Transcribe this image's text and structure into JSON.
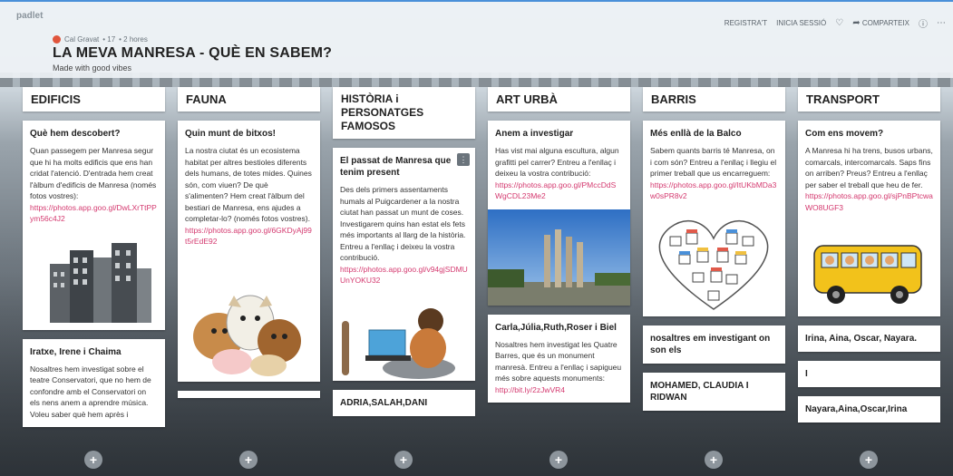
{
  "app": {
    "brand": "padlet"
  },
  "header": {
    "author": "Cal Gravat",
    "likes": "• 17",
    "time": "• 2 hores",
    "title": "LA MEVA MANRESA - QUÈ EN SABEM?",
    "subtitle": "Made with good vibes",
    "register": "REGISTRA'T",
    "login": "INICIA SESSIÓ",
    "share": "COMPARTEIX",
    "heart_icon": "heart-icon",
    "share_icon": "share-icon",
    "help_icon": "help-icon",
    "more_icon": "more-icon"
  },
  "columns": [
    {
      "title": "EDIFICIS",
      "cards": [
        {
          "title": "Què hem descobert?",
          "body": "Quan passegem per Manresa segur que hi ha molts edificis que ens han cridat l'atenció. D'entrada hem creat l'àlbum d'edificis de Manresa (només fotos vostres):",
          "link": "https://photos.app.goo.gl/DwLXrTtPPym56c4J2"
        },
        {
          "title": "Iratxe, Irene i Chaima",
          "body": "Nosaltres hem investigat sobre el teatre Conservatori, que no hem de confondre amb el Conservatori on els nens anem a aprendre música. Voleu saber què hem après i"
        }
      ]
    },
    {
      "title": "FAUNA",
      "cards": [
        {
          "title": "Quin munt de bitxos!",
          "body": "La nostra ciutat és un ecosistema habitat per altres bestioles diferents dels humans, de totes mides. Quines són, com viuen? De què s'alimenten? Hem creat l'àlbum del bestiari de Manresa, ens ajudes a completar-lo? (només fotos vostres).",
          "link": "https://photos.app.goo.gl/6GKDyAj99t5rEdE92"
        }
      ]
    },
    {
      "title": "HISTÒRIA i PERSONATGES FAMOSOS",
      "cards": [
        {
          "title": "El passat de Manresa que tenim present",
          "body": "Des dels primers assentaments humals al Puigcardener a la nostra ciutat han passat un munt de coses. Investigarem quins han estat els fets més importants al llarg de la història. Entreu a l'enllaç i deixeu la vostra contribució.",
          "link": "https://photos.app.goo.gl/v94gjSDMUUnYOKU32",
          "menu": "⋮"
        },
        {
          "title": "ADRIA,SALAH,DANI"
        }
      ]
    },
    {
      "title": "ART URBÀ",
      "cards": [
        {
          "title": "Anem a investigar",
          "body": "Has vist mai alguna escultura, algun grafitti pel carrer? Entreu a l'enllaç i deixeu la vostra contribució:",
          "link": "https://photos.app.goo.gl/PMccDdSWgCDL23Me2"
        },
        {
          "title": "Carla,Júlia,Ruth,Roser i Biel",
          "body": "Nosaltres hem investigat les Quatre Barres, que és un monument manresà. Entreu a l'enllaç i sapigueu més sobre aquests monuments:",
          "link": "http://bit.ly/2zJwVR4"
        }
      ]
    },
    {
      "title": "BARRIS",
      "cards": [
        {
          "title": "Més enllà de la Balco",
          "body": "Sabem quants barris té Manresa, on i com són? Entreu a l'enllaç i llegiu el primer treball que us encarreguem:",
          "link": "https://photos.app.goo.gl/ItUKbMDa3w0sPR8v2"
        },
        {
          "title": "nosaltres em investigant on son els"
        },
        {
          "title": "MOHAMED, CLAUDIA I RIDWAN"
        }
      ]
    },
    {
      "title": "TRANSPORT",
      "cards": [
        {
          "title": "Com ens movem?",
          "body": "A Manresa hi ha trens, busos urbans, comarcals, intercomarcals. Saps fins on arriben? Preus? Entreu a l'enllaç per saber el treball que heu de fer.",
          "link": "https://photos.app.goo.gl/sjPnBPtcwaWO8UGF3"
        },
        {
          "title": "Irina, Aina, Oscar, Nayara."
        },
        {
          "title": "I"
        },
        {
          "title": "Nayara,Aina,Oscar,Irina"
        }
      ]
    }
  ],
  "add_label": "+"
}
